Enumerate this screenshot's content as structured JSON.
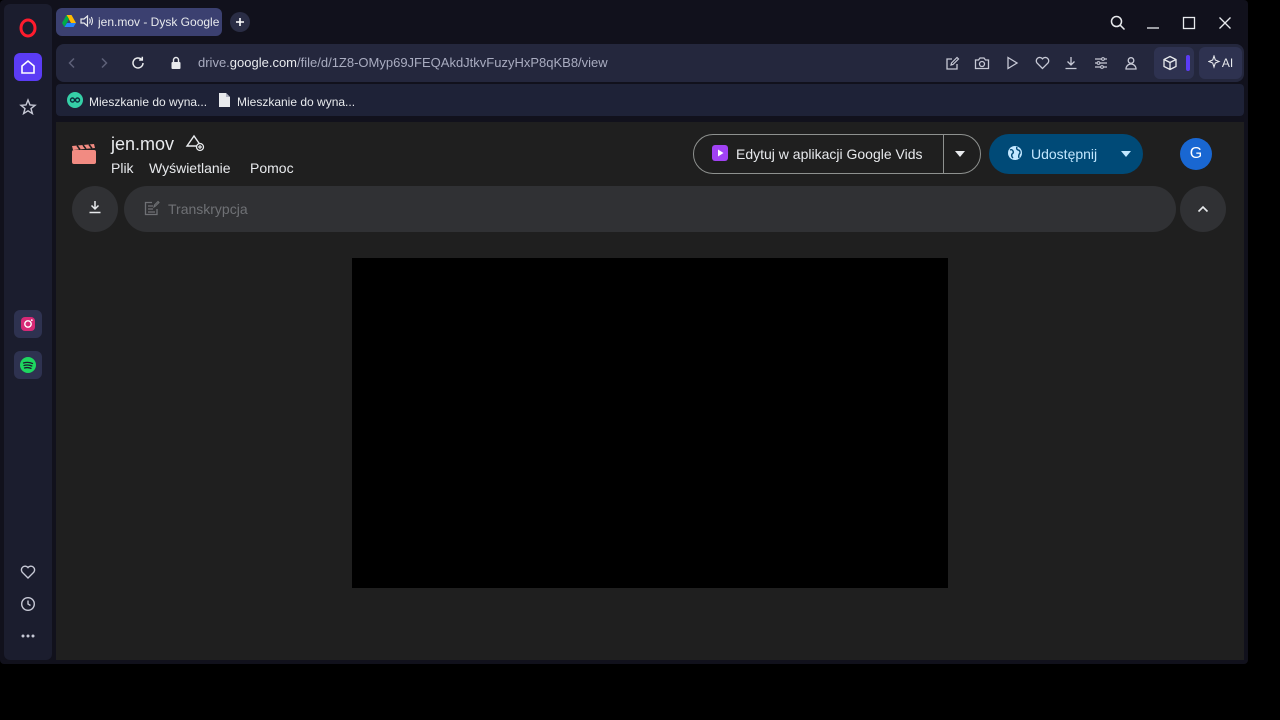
{
  "browser": {
    "tab": {
      "title": "jen.mov - Dysk Google",
      "audio_icon": "speaker-icon"
    },
    "address": {
      "url_prefix": "drive.",
      "url_domain": "google.com",
      "url_path": "/file/d/1Z8-OMyp69JFEQAkdJtkvFuzyHxP8qKB8/view"
    },
    "ai_label": "AI",
    "bookmarks": [
      {
        "label": "Mieszkanie do wyna...",
        "icon": "otodom-icon"
      },
      {
        "label": "Mieszkanie do wyna...",
        "icon": "document-icon"
      }
    ]
  },
  "drive": {
    "filename": "jen.mov",
    "menu": [
      "Plik",
      "Wyświetlanie",
      "Pomoc"
    ],
    "edit_button": "Edytuj w aplikacji Google Vids",
    "share_button": "Udostępnij",
    "avatar_letter": "G",
    "transcript_label": "Transkrypcja"
  },
  "colors": {
    "share_bg": "#004a77",
    "avatar_bg": "#1967d2",
    "opera_red": "#ff1b2d",
    "sidebar_accent": "#5b3cf5"
  }
}
